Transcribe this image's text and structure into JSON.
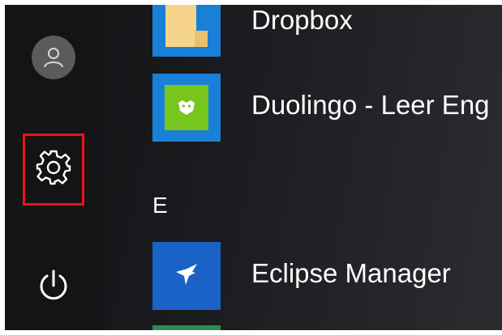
{
  "start_menu": {
    "rail": {
      "user_icon": "user-avatar-icon",
      "settings_icon": "gear-icon",
      "power_icon": "power-icon",
      "highlight_color": "#e8141a"
    },
    "apps": [
      {
        "name": "Dropbox",
        "tile_color": "#1a7fd6",
        "icon": "dropbox-folder-icon"
      },
      {
        "name": "Duolingo - Leer Eng",
        "tile_color": "#1a7fd6",
        "inner_color": "#77c51d",
        "icon": "duolingo-owl-icon"
      },
      {
        "name": "Eclipse Manager",
        "tile_color": "#1a62c6",
        "icon": "eclipse-bird-icon"
      }
    ],
    "section_header": "E",
    "partial_tile_color": "#2e8b56"
  }
}
